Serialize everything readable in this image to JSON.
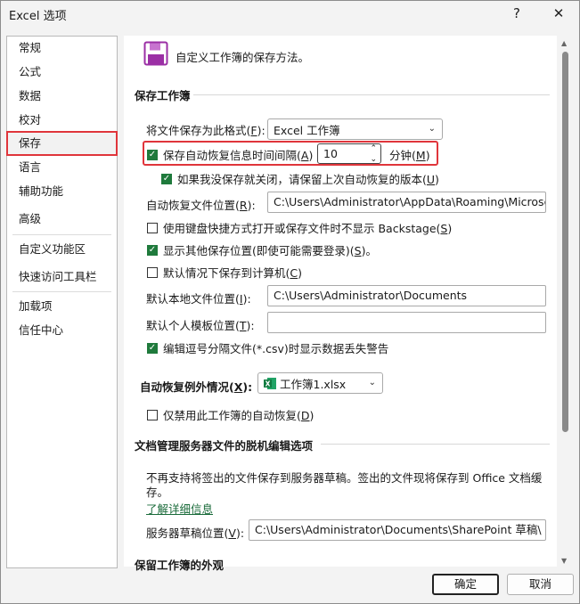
{
  "window": {
    "title": "Excel 选项",
    "help_glyph": "?",
    "close_glyph": "✕"
  },
  "sidebar": {
    "items": [
      {
        "label": "常规"
      },
      {
        "label": "公式"
      },
      {
        "label": "数据"
      },
      {
        "label": "校对"
      },
      {
        "label": "保存"
      },
      {
        "label": "语言"
      },
      {
        "label": "辅助功能"
      },
      {
        "label": "高级"
      },
      {
        "label": "自定义功能区"
      },
      {
        "label": "快速访问工具栏"
      },
      {
        "label": "加载项"
      },
      {
        "label": "信任中心"
      }
    ],
    "selected": "保存"
  },
  "header": {
    "text": "自定义工作簿的保存方法。"
  },
  "save_section": {
    "heading": "保存工作簿",
    "format_label": "将文件保存为此格式(",
    "format_key": "F",
    "format_tail": "):",
    "format_value": "Excel 工作簿",
    "autorecover_label": "保存自动恢复信息时间间隔(",
    "autorecover_key": "A",
    "autorecover_tail": ")",
    "autorecover_checked": true,
    "autorecover_minutes": "10",
    "minutes_unit": "分钟(",
    "minutes_key": "M",
    "minutes_tail": ")",
    "keep_last_label": "如果我没保存就关闭，请保留上次自动恢复的版本(",
    "keep_last_key": "U",
    "keep_last_tail": ")",
    "autorecover_loc_label": "自动恢复文件位置(",
    "autorecover_loc_key": "R",
    "autorecover_loc_tail": "):",
    "autorecover_loc_value": "C:\\Users\\Administrator\\AppData\\Roaming\\Microsoft",
    "no_backstage_label": "使用键盘快捷方式打开或保存文件时不显示 Backstage(",
    "no_backstage_key": "S",
    "no_backstage_tail": ")",
    "show_other_label": "显示其他保存位置(即使可能需要登录)(",
    "show_other_key": "S",
    "show_other_tail": ")。",
    "default_computer_label": "默认情况下保存到计算机(",
    "default_computer_key": "C",
    "default_computer_tail": ")",
    "local_loc_label": "默认本地文件位置(",
    "local_loc_key": "I",
    "local_loc_tail": "):",
    "local_loc_value": "C:\\Users\\Administrator\\Documents",
    "template_loc_label": "默认个人模板位置(",
    "template_loc_key": "T",
    "template_loc_tail": "):",
    "template_loc_value": "",
    "csv_warn_label": "编辑逗号分隔文件(*.csv)时显示数据丢失警告"
  },
  "exceptions": {
    "label": "自动恢复例外情况(",
    "label_key": "X",
    "label_tail": "):",
    "workbook": "工作簿1.xlsx",
    "disable_label": "仅禁用此工作簿的自动恢复(",
    "disable_key": "D",
    "disable_tail": ")"
  },
  "offline": {
    "heading": "文档管理服务器文件的脱机编辑选项",
    "desc_line1": "不再支持将签出的文件保存到服务器草稿。签出的文件现将保存到 Office 文档缓",
    "desc_line2": "存。",
    "learn_more": "了解详细信息",
    "drafts_label": "服务器草稿位置(",
    "drafts_key": "V",
    "drafts_tail": "):",
    "drafts_value": "C:\\Users\\Administrator\\Documents\\SharePoint 草稿\\"
  },
  "appearance": {
    "heading": "保留工作簿的外观"
  },
  "footer": {
    "ok": "确定",
    "cancel": "取消"
  },
  "colors": {
    "accent_green": "#1f7a3c",
    "highlight_red": "#e0353b"
  },
  "icons": {
    "save": "floppy-save-icon",
    "excel": "excel-file-icon"
  }
}
